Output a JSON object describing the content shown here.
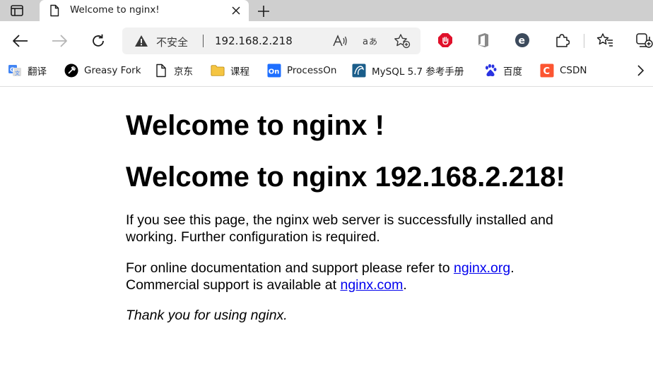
{
  "tab": {
    "title": "Welcome to nginx!"
  },
  "addressbar": {
    "security_label": "不安全",
    "url": "192.168.2.218"
  },
  "bookmarks": [
    {
      "label": "翻译",
      "icon": "google-translate-icon"
    },
    {
      "label": "Greasy Fork",
      "icon": "greasyfork-icon"
    },
    {
      "label": "京东",
      "icon": "page-icon"
    },
    {
      "label": "课程",
      "icon": "folder-icon"
    },
    {
      "label": "ProcessOn",
      "icon": "processon-icon"
    },
    {
      "label": "MySQL 5.7 参考手册",
      "icon": "mysql-icon"
    },
    {
      "label": "百度",
      "icon": "baidu-icon"
    },
    {
      "label": "CSDN",
      "icon": "csdn-icon"
    }
  ],
  "page": {
    "heading1": "Welcome to nginx !",
    "heading2": "Welcome to nginx 192.168.2.218!",
    "para1": "If you see this page, the nginx web server is successfully installed and working. Further configuration is required.",
    "para2_prefix": "For online documentation and support please refer to ",
    "para2_link1": "nginx.org",
    "para2_mid": ".",
    "para2_line2": "Commercial support is available at ",
    "para2_link2": "nginx.com",
    "para2_end": ".",
    "para3": "Thank you for using nginx."
  },
  "colors": {
    "tabstrip_bg": "#cfcfcf",
    "link": "#0000ee",
    "adblock_red": "#e0102a",
    "csdn_red": "#fc5531",
    "processon_blue": "#1e6fff"
  }
}
